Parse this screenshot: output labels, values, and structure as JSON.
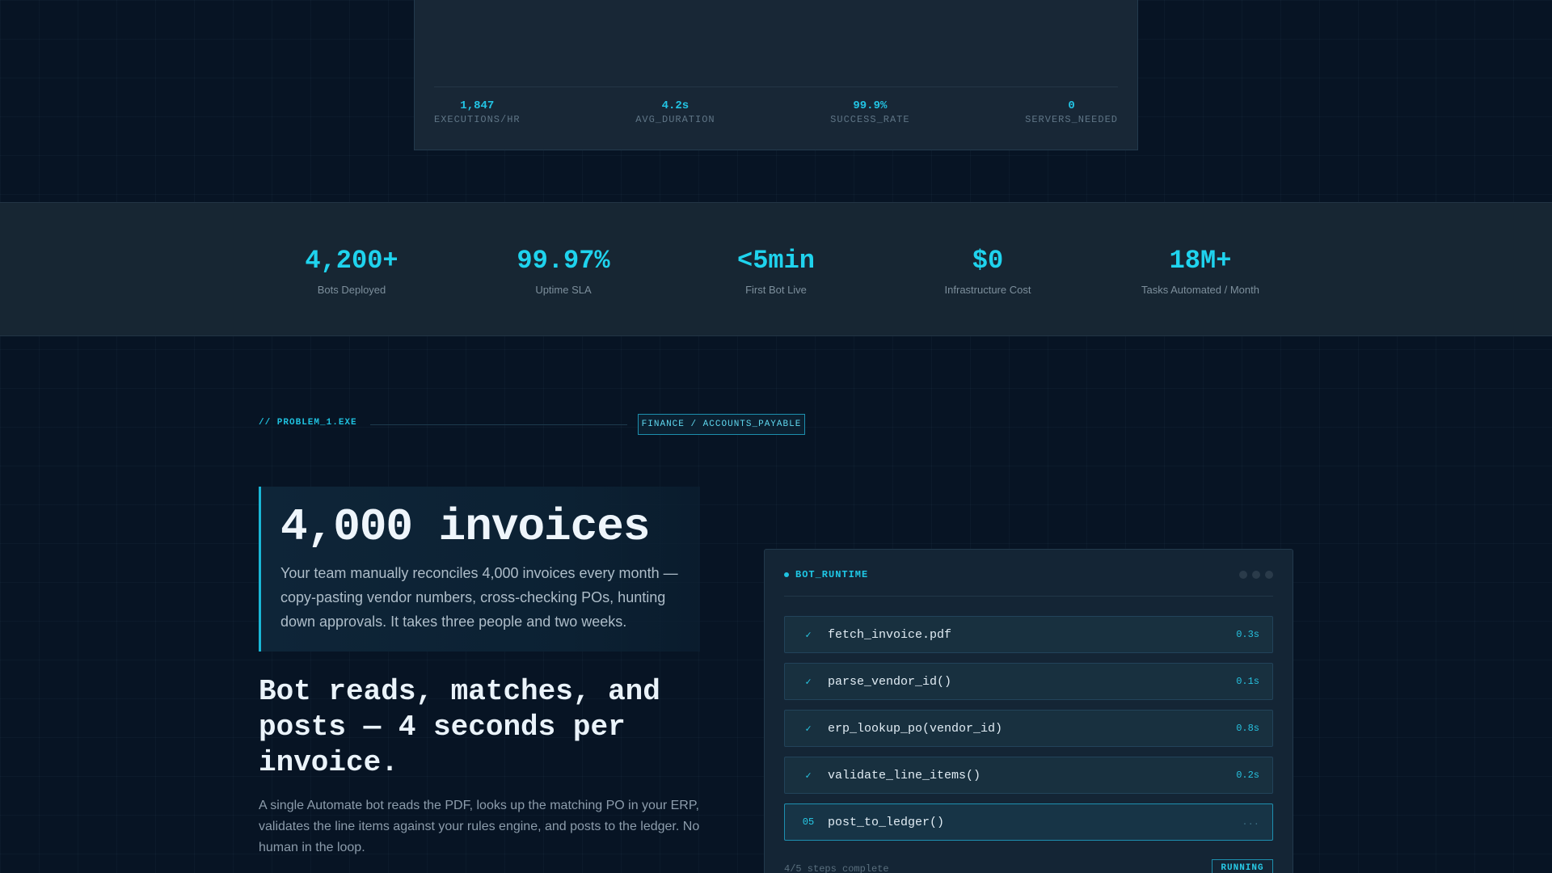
{
  "monitor": {
    "stats": [
      {
        "value": "1,847",
        "label": "EXECUTIONS/HR"
      },
      {
        "value": "4.2s",
        "label": "AVG_DURATION"
      },
      {
        "value": "99.9%",
        "label": "SUCCESS_RATE"
      },
      {
        "value": "0",
        "label": "SERVERS_NEEDED"
      }
    ]
  },
  "stats_band": {
    "items": [
      {
        "value": "4,200+",
        "label": "Bots Deployed"
      },
      {
        "value": "99.97%",
        "label": "Uptime SLA"
      },
      {
        "value": "<5min",
        "label": "First Bot Live"
      },
      {
        "value": "$0",
        "label": "Infrastructure Cost"
      },
      {
        "value": "18M+",
        "label": "Tasks Automated / Month"
      }
    ]
  },
  "problem": {
    "tag": "// PROBLEM_1.EXE",
    "category": "FINANCE / ACCOUNTS_PAYABLE",
    "headline": "4,000 invoices",
    "description": "Your team manually reconciles 4,000 invoices every month — copy-pasting vendor numbers, cross-checking POs, hunting down approvals. It takes three people and two weeks.",
    "solution_title": "Bot reads, matches, and posts — 4 seconds per invoice.",
    "solution_description": "A single Automate bot reads the PDF, looks up the matching PO in your ERP, validates the line items against your rules engine, and posts to the ledger. No human in the loop."
  },
  "runtime": {
    "title": "BOT_RUNTIME",
    "steps": [
      {
        "marker": "✓",
        "name": "fetch_invoice.pdf",
        "time": "0.3s",
        "status": "done"
      },
      {
        "marker": "✓",
        "name": "parse_vendor_id()",
        "time": "0.1s",
        "status": "done"
      },
      {
        "marker": "✓",
        "name": "erp_lookup_po(vendor_id)",
        "time": "0.8s",
        "status": "done"
      },
      {
        "marker": "✓",
        "name": "validate_line_items()",
        "time": "0.2s",
        "status": "done"
      },
      {
        "marker": "05",
        "name": "post_to_ledger()",
        "time": "...",
        "status": "active"
      }
    ],
    "progress_text": "4/5 steps complete",
    "status_badge": "RUNNING",
    "accent_color": "#1fc8e6"
  }
}
